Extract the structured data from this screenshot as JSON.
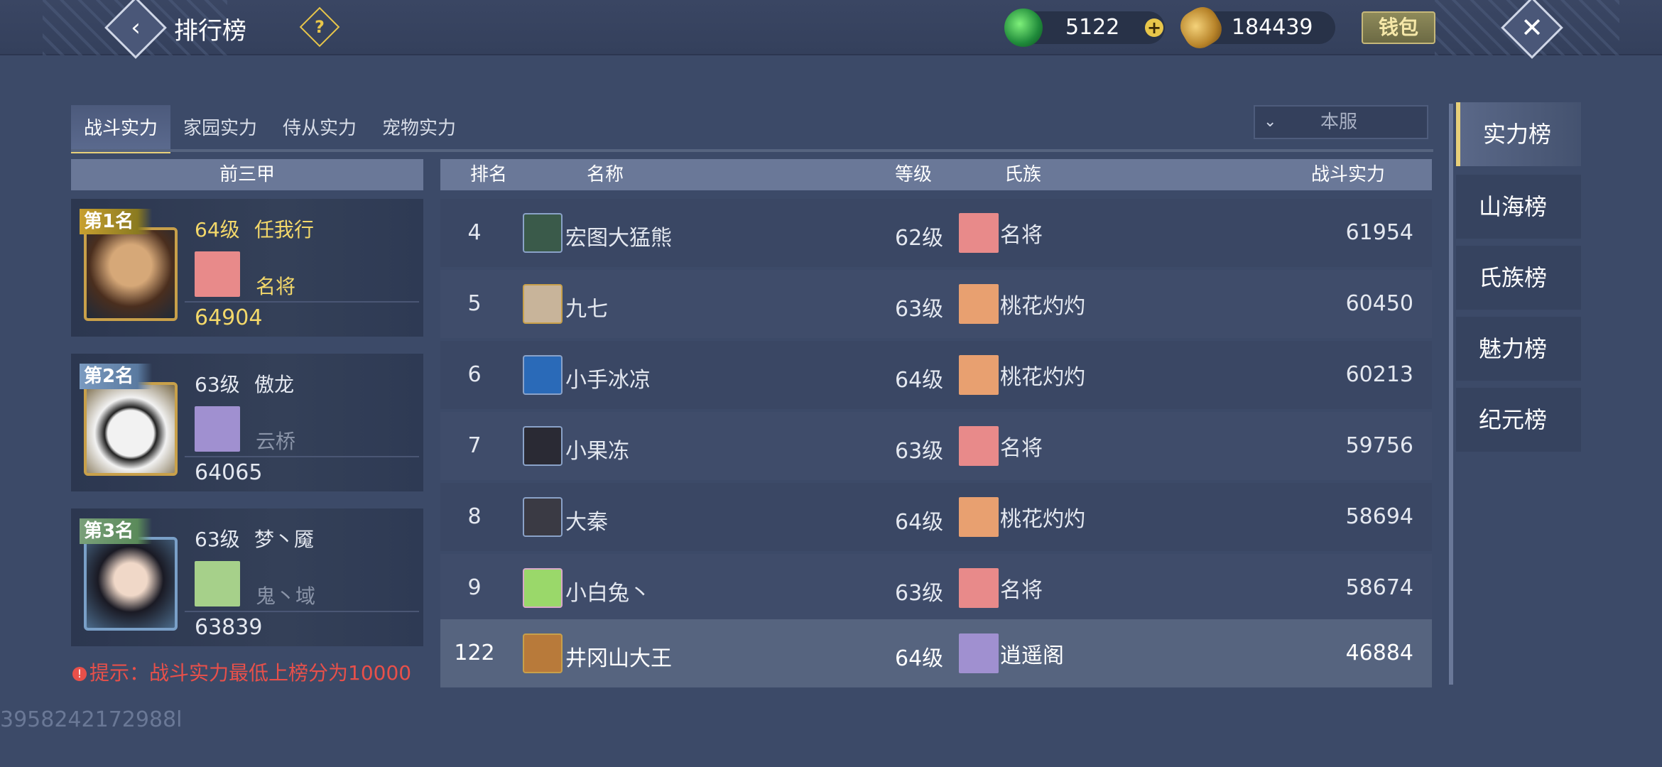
{
  "header": {
    "title": "排行榜",
    "jade": "5122",
    "coins": "184439",
    "wallet": "钱包"
  },
  "tabs": [
    "战斗实力",
    "家园实力",
    "侍从实力",
    "宠物实力"
  ],
  "server": "本服",
  "top3": {
    "header": "前三甲",
    "cards": [
      {
        "rank": "第1名",
        "level": "64级",
        "name": "任我行",
        "clan": "名将",
        "power": "64904"
      },
      {
        "rank": "第2名",
        "level": "63级",
        "name": "傲龙",
        "clan": "云桥",
        "power": "64065"
      },
      {
        "rank": "第3名",
        "level": "63级",
        "name": "梦丶魇",
        "clan": "鬼丶域",
        "power": "63839"
      }
    ]
  },
  "hint": "提示：战斗实力最低上榜分为10000",
  "uid": "3958242172988l",
  "table": {
    "headers": {
      "rank": "排名",
      "name": "名称",
      "level": "等级",
      "clan": "氏族",
      "power": "战斗实力"
    },
    "rows": [
      {
        "rank": "4",
        "name": "宏图大猛熊",
        "level": "62级",
        "clan": "名将",
        "power": "61954"
      },
      {
        "rank": "5",
        "name": "九七",
        "level": "63级",
        "clan": "桃花灼灼",
        "power": "60450"
      },
      {
        "rank": "6",
        "name": "小手冰凉",
        "level": "64级",
        "clan": "桃花灼灼",
        "power": "60213"
      },
      {
        "rank": "7",
        "name": "小果冻",
        "level": "63级",
        "clan": "名将",
        "power": "59756"
      },
      {
        "rank": "8",
        "name": "大秦",
        "level": "64级",
        "clan": "桃花灼灼",
        "power": "58694"
      },
      {
        "rank": "9",
        "name": "小白兔丶",
        "level": "63级",
        "clan": "名将",
        "power": "58674"
      }
    ],
    "me": {
      "rank": "122",
      "name": "井冈山大王",
      "level": "64级",
      "clan": "逍遥阁",
      "power": "46884"
    }
  },
  "side_tabs": [
    "实力榜",
    "山海榜",
    "氏族榜",
    "魅力榜",
    "纪元榜"
  ]
}
